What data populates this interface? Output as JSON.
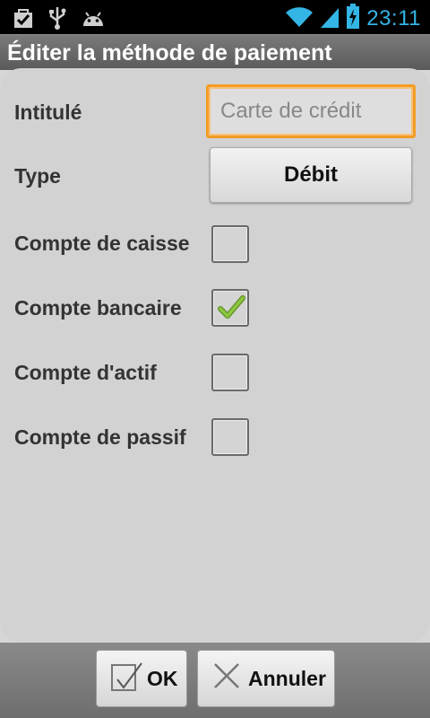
{
  "status": {
    "time": "23:11"
  },
  "title": "Éditer la méthode de paiement",
  "form": {
    "name_label": "Intitulé",
    "name_placeholder": "Carte de crédit",
    "type_label": "Type",
    "type_value": "Débit",
    "checks": [
      {
        "label": "Compte de caisse",
        "checked": false
      },
      {
        "label": "Compte bancaire",
        "checked": true
      },
      {
        "label": "Compte d'actif",
        "checked": false
      },
      {
        "label": "Compte de passif",
        "checked": false
      }
    ]
  },
  "buttons": {
    "ok": "OK",
    "cancel": "Annuler"
  },
  "colors": {
    "accent": "#33b5e5",
    "focus": "#f39c26",
    "check": "#8cc63f"
  }
}
